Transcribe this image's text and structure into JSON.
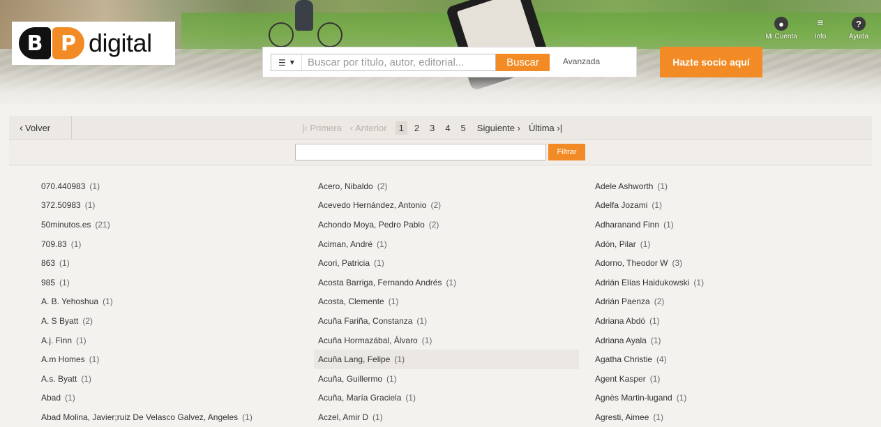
{
  "header": {
    "logo_b": "B",
    "logo_p": "P",
    "logo_text": "digital",
    "search": {
      "menu_icon": "list-icon",
      "placeholder": "Buscar por título, autor, editorial...",
      "button": "Buscar",
      "advanced": "Avanzada"
    },
    "cta": "Hazte socio aquí",
    "top_icons": [
      {
        "icon": "user-icon",
        "label": "Mi Cuenta"
      },
      {
        "icon": "menu-icon",
        "label": "Info"
      },
      {
        "icon": "help-icon",
        "label": "Ayuda"
      }
    ]
  },
  "toolbar": {
    "back": "Volver",
    "first": "Primera",
    "prev": "Anterior",
    "pages": [
      "1",
      "2",
      "3",
      "4",
      "5"
    ],
    "current_page": "1",
    "next": "Siguiente",
    "last": "Última"
  },
  "filter": {
    "value": "",
    "button": "Filtrar"
  },
  "columns": [
    [
      {
        "name": "070.440983",
        "count": "(1)"
      },
      {
        "name": "372.50983",
        "count": "(1)"
      },
      {
        "name": "50minutos.es",
        "count": "(21)"
      },
      {
        "name": "709.83",
        "count": "(1)"
      },
      {
        "name": "863",
        "count": "(1)"
      },
      {
        "name": "985",
        "count": "(1)"
      },
      {
        "name": "A. B. Yehoshua",
        "count": "(1)"
      },
      {
        "name": "A. S Byatt",
        "count": "(2)"
      },
      {
        "name": "A.j. Finn",
        "count": "(1)"
      },
      {
        "name": "A.m Homes",
        "count": "(1)"
      },
      {
        "name": "A.s. Byatt",
        "count": "(1)"
      },
      {
        "name": "Abad",
        "count": "(1)"
      },
      {
        "name": "Abad Molina, Javier;ruiz De Velasco Galvez, Angeles",
        "count": "(1)"
      }
    ],
    [
      {
        "name": "Acero, Nibaldo",
        "count": "(2)"
      },
      {
        "name": "Acevedo Hernández, Antonio",
        "count": "(2)"
      },
      {
        "name": "Achondo Moya, Pedro Pablo",
        "count": "(2)"
      },
      {
        "name": "Aciman, André",
        "count": "(1)"
      },
      {
        "name": "Acori, Patricia",
        "count": "(1)"
      },
      {
        "name": "Acosta Barriga, Fernando Andrés",
        "count": "(1)"
      },
      {
        "name": "Acosta, Clemente",
        "count": "(1)"
      },
      {
        "name": "Acuña Fariña, Constanza",
        "count": "(1)"
      },
      {
        "name": "Acuña Hormazábal, Álvaro",
        "count": "(1)"
      },
      {
        "name": "Acuña Lang, Felipe",
        "count": "(1)"
      },
      {
        "name": "Acuña, Guillermo",
        "count": "(1)"
      },
      {
        "name": "Acuña, María Graciela",
        "count": "(1)"
      },
      {
        "name": "Aczel, Amir D",
        "count": "(1)"
      }
    ],
    [
      {
        "name": "Adele Ashworth",
        "count": "(1)"
      },
      {
        "name": "Adelfa Jozami",
        "count": "(1)"
      },
      {
        "name": "Adharanand Finn",
        "count": "(1)"
      },
      {
        "name": "Adón, Pilar",
        "count": "(1)"
      },
      {
        "name": "Adorno, Theodor W",
        "count": "(3)"
      },
      {
        "name": "Adrián Elías Haidukowski",
        "count": "(1)"
      },
      {
        "name": "Adrián Paenza",
        "count": "(2)"
      },
      {
        "name": "Adriana Abdó",
        "count": "(1)"
      },
      {
        "name": "Adriana Ayala",
        "count": "(1)"
      },
      {
        "name": "Agatha Christie",
        "count": "(4)"
      },
      {
        "name": "Agent Kasper",
        "count": "(1)"
      },
      {
        "name": "Agnès Martin-lugand",
        "count": "(1)"
      },
      {
        "name": "Agresti, Aimee",
        "count": "(1)"
      }
    ]
  ],
  "colors": {
    "accent": "#f28b25",
    "background": "#f4f2ef"
  }
}
